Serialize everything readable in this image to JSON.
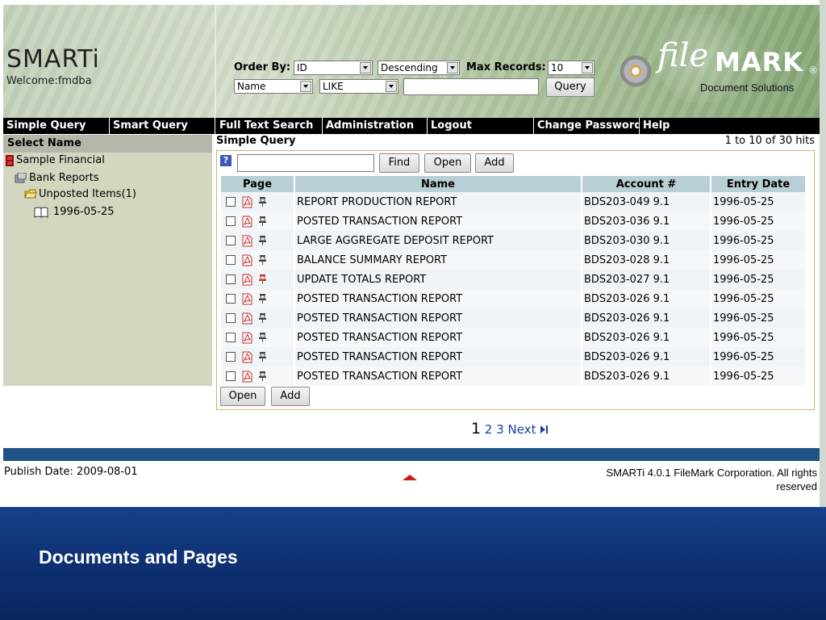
{
  "header": {
    "app_title": "SMARTi",
    "welcome": "Welcome:fmdba",
    "order_by_label": "Order By:",
    "order_by_value": "ID",
    "order_dir_value": "Descending",
    "max_records_label": "Max Records:",
    "max_records_value": "10",
    "field_value": "Name",
    "operator_value": "LIKE",
    "query_value": "",
    "query_button": "Query",
    "logo_file": "file",
    "logo_mark": "MARK",
    "logo_reg": "®",
    "logo_sub": "Document Solutions"
  },
  "nav": {
    "items": [
      "Simple Query",
      "Smart Query",
      "Full Text Search",
      "Administration",
      "Logout",
      "Change Password",
      "Help"
    ]
  },
  "sidebar": {
    "heading": "Select Name",
    "tree": [
      "Sample Financial",
      "Bank Reports",
      "Unposted Items(1)",
      "1996-05-25"
    ]
  },
  "main": {
    "title": "Simple Query",
    "hits": "1 to 10 of 30 hits",
    "search_value": "",
    "buttons": {
      "find": "Find",
      "open": "Open",
      "add": "Add"
    },
    "columns": [
      "Page",
      "Name",
      "Account #",
      "Entry Date"
    ],
    "rows": [
      {
        "name": "REPORT PRODUCTION REPORT",
        "account": "BDS203-049 9.1",
        "date": "1996-05-25",
        "pin_active": false
      },
      {
        "name": "POSTED TRANSACTION REPORT",
        "account": "BDS203-036 9.1",
        "date": "1996-05-25",
        "pin_active": false
      },
      {
        "name": "LARGE AGGREGATE DEPOSIT REPORT",
        "account": "BDS203-030 9.1",
        "date": "1996-05-25",
        "pin_active": false
      },
      {
        "name": "BALANCE SUMMARY REPORT",
        "account": "BDS203-028 9.1",
        "date": "1996-05-25",
        "pin_active": false
      },
      {
        "name": "UPDATE TOTALS REPORT",
        "account": "BDS203-027 9.1",
        "date": "1996-05-25",
        "pin_active": true
      },
      {
        "name": "POSTED TRANSACTION REPORT",
        "account": "BDS203-026 9.1",
        "date": "1996-05-25",
        "pin_active": false
      },
      {
        "name": "POSTED TRANSACTION REPORT",
        "account": "BDS203-026 9.1",
        "date": "1996-05-25",
        "pin_active": false
      },
      {
        "name": "POSTED TRANSACTION REPORT",
        "account": "BDS203-026 9.1",
        "date": "1996-05-25",
        "pin_active": false
      },
      {
        "name": "POSTED TRANSACTION REPORT",
        "account": "BDS203-026 9.1",
        "date": "1996-05-25",
        "pin_active": false
      },
      {
        "name": "POSTED TRANSACTION REPORT",
        "account": "BDS203-026 9.1",
        "date": "1996-05-25",
        "pin_active": false
      }
    ],
    "bottom_buttons": {
      "open": "Open",
      "add": "Add"
    }
  },
  "pager": {
    "current": "1",
    "pages": [
      "2",
      "3"
    ],
    "next": "Next",
    "last_icon": "skip-last-icon"
  },
  "footer": {
    "publish_date": "Publish Date: 2009-08-01",
    "copyright_line1": "SMARTi 4.0.1 FileMark Corporation. All rights",
    "copyright_line2": "reserved"
  },
  "slide": {
    "title": "Documents and Pages"
  },
  "colors": {
    "nav_bg": "#000000",
    "header_row": "#b8cfd5",
    "footer_bar": "#1f5385",
    "slide_bg": "#0d2f6f",
    "pin_active": "#c0392b"
  }
}
